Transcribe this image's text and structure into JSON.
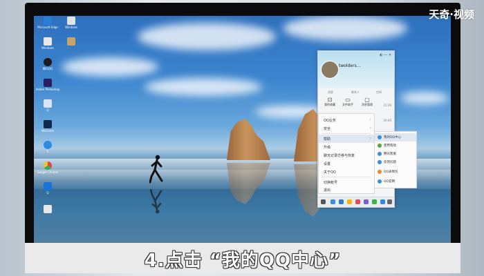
{
  "watermark": "天奇·视频",
  "caption": "4.点击 “我的QQ中心”",
  "desktop": {
    "icons": [
      {
        "label": "Microsoft Edge",
        "color": "#2a7fd4"
      },
      {
        "label": "Windows",
        "color": "#e9e9e9"
      },
      {
        "label": "腾讯QQ",
        "color": "#1b1b1b"
      },
      {
        "label": "Adobe Photoshop",
        "color": "#2a1f5e"
      },
      {
        "label": "Q",
        "color": "#d8e6f5"
      },
      {
        "label": "WeGame",
        "color": "#0e2a4d"
      },
      {
        "label": "E",
        "color": "#2d8be0"
      },
      {
        "label": "Google Chrome",
        "color": "#e6c63a"
      },
      {
        "label": "Q",
        "color": "#1b73d8"
      },
      {
        "label": "",
        "color": "#e8e8e8"
      }
    ],
    "icons_col2": [
      {
        "label": "Windows",
        "color": "#e3e3e3"
      },
      {
        "label": "",
        "color": "#c9a46a"
      }
    ]
  },
  "qq": {
    "nickname": "twolders...",
    "tabs": [
      "消息",
      "联系人",
      "空间"
    ],
    "tools": [
      {
        "icon": "⊡",
        "label": "我的收藏"
      },
      {
        "icon": "▭",
        "label": "文件助手"
      },
      {
        "icon": "▢",
        "label": "消息管理"
      }
    ],
    "times": [
      "21:26",
      "20:44",
      "17:24"
    ],
    "menu": [
      {
        "label": "QQ业务",
        "arrow": "›"
      },
      {
        "label": "安全",
        "arrow": "›"
      },
      {
        "label": "帮助",
        "arrow": "›"
      },
      {
        "label": "升级",
        "arrow": ""
      },
      {
        "label": "聊天记录迁移与恢复",
        "arrow": ""
      },
      {
        "label": "设置",
        "arrow": ""
      },
      {
        "label": "关于QQ",
        "arrow": ""
      },
      {
        "label": "切换帐号",
        "arrow": ""
      },
      {
        "label": "退出",
        "arrow": ""
      }
    ],
    "submenu": [
      {
        "label": "我的QQ中心",
        "color": "#3b8fd9"
      },
      {
        "label": "使用帮助",
        "color": "#5aa23c"
      },
      {
        "label": "腾讯客服",
        "color": "#3b8fd9"
      },
      {
        "label": "反馈问题",
        "color": "#3b8fd9"
      },
      {
        "label": "QQ表情包",
        "color": "#e58a2f"
      },
      {
        "label": "QQ官网",
        "color": "#3b8fd9"
      }
    ]
  }
}
